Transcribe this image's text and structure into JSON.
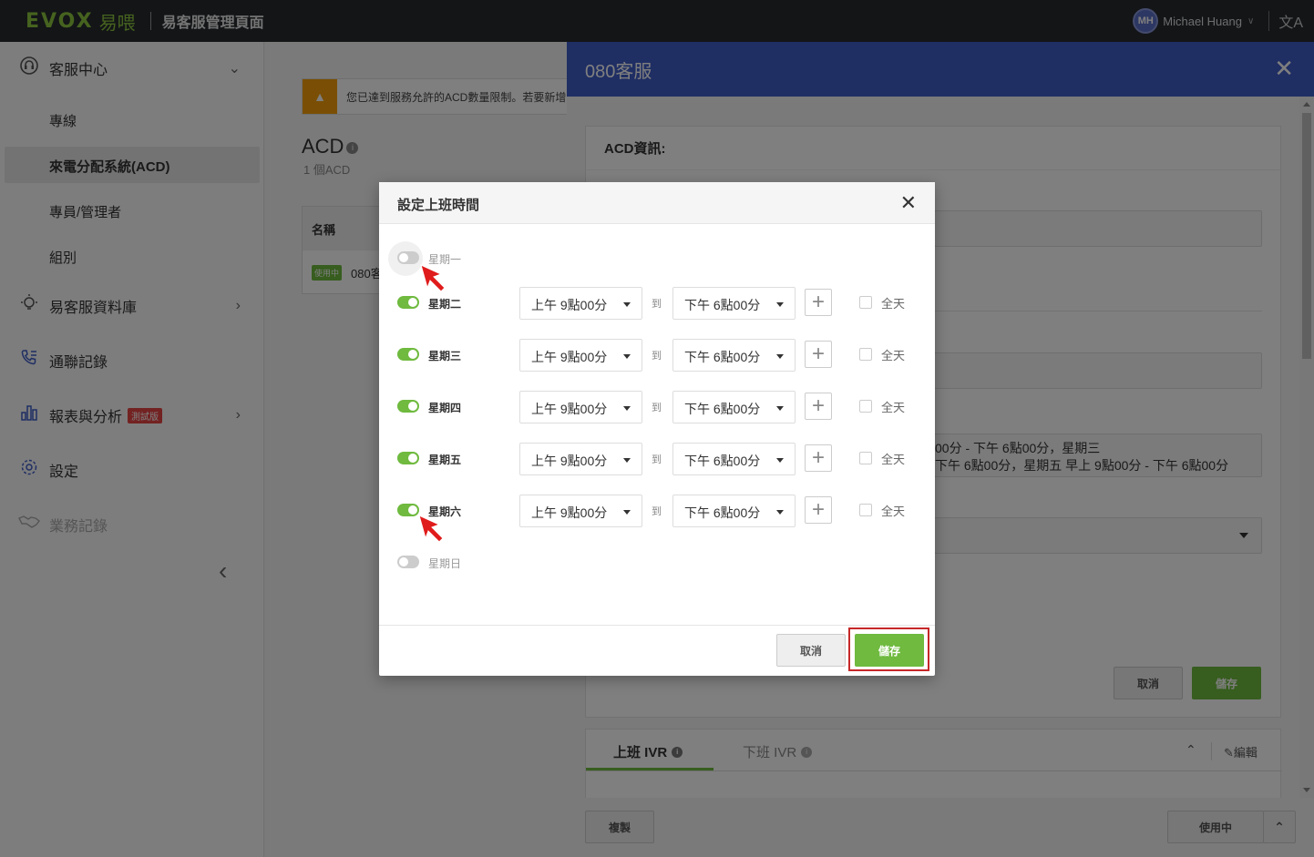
{
  "topbar": {
    "logo_text": "EVOX",
    "logo_cn": "易喂",
    "app_title": "易客服管理頁面",
    "user_initials": "MH",
    "user_name": "Michael Huang",
    "lang_icon": "translate-icon"
  },
  "sidebar": {
    "section": {
      "label": "客服中心",
      "icon": "headset-icon"
    },
    "sub_items": [
      {
        "label": "專線",
        "active": false
      },
      {
        "label": "來電分配系統(ACD)",
        "active": true
      },
      {
        "label": "專員/管理者",
        "active": false
      },
      {
        "label": "組別",
        "active": false
      }
    ],
    "items": [
      {
        "label": "易客服資料庫",
        "icon": "lightbulb-icon"
      },
      {
        "label": "通聯記錄",
        "icon": "phone-log-icon"
      },
      {
        "label": "報表與分析",
        "icon": "chart-icon",
        "badge": "測試版"
      },
      {
        "label": "設定",
        "icon": "gear-icon"
      },
      {
        "label": "業務記錄",
        "icon": "handshake-icon"
      }
    ]
  },
  "main": {
    "warning": "您已達到服務允許的ACD數量限制。若要新增",
    "title": "ACD",
    "count": "1 個ACD",
    "table_header": "名稱",
    "row_tag": "使用中",
    "row_name": "080客"
  },
  "drawer": {
    "title": "080客服",
    "card_title": "ACD資訊:",
    "schedule_line1": "00分 - 下午 6點00分，星期三",
    "schedule_line2": "下午 6點00分，星期五  早上 9點00分 - 下午 6點00分",
    "cancel_label": "取消",
    "save_label": "儲存",
    "ivr_tab_on": "上班 IVR",
    "ivr_tab_off": "下班 IVR",
    "edit_label": "編輯",
    "copy_label": "複製",
    "status_label": "使用中"
  },
  "modal": {
    "title": "設定上班時間",
    "to_label": "到",
    "all_day_label": "全天",
    "cancel_label": "取消",
    "save_label": "儲存",
    "days": [
      {
        "label": "星期一",
        "enabled": false
      },
      {
        "label": "星期二",
        "enabled": true,
        "start": "上午 9點00分",
        "end": "下午 6點00分"
      },
      {
        "label": "星期三",
        "enabled": true,
        "start": "上午 9點00分",
        "end": "下午 6點00分"
      },
      {
        "label": "星期四",
        "enabled": true,
        "start": "上午 9點00分",
        "end": "下午 6點00分"
      },
      {
        "label": "星期五",
        "enabled": true,
        "start": "上午 9點00分",
        "end": "下午 6點00分"
      },
      {
        "label": "星期六",
        "enabled": true,
        "start": "上午 9點00分",
        "end": "下午 6點00分"
      },
      {
        "label": "星期日",
        "enabled": false
      }
    ]
  },
  "colors": {
    "accent_green": "#6fba3f",
    "header_blue": "#3f5dc7",
    "highlight_red": "#c62828"
  }
}
